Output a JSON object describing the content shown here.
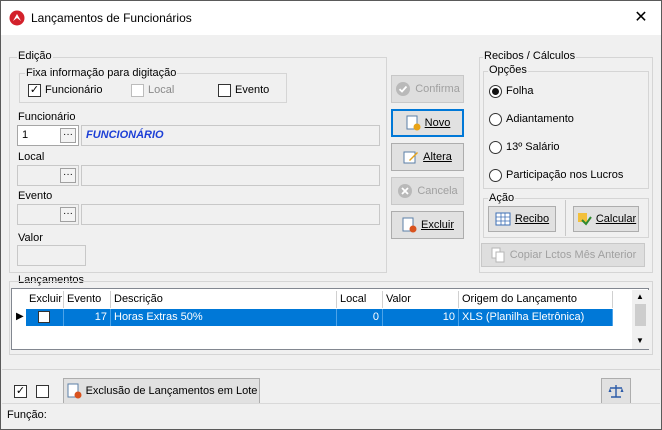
{
  "window": {
    "title": "Lançamentos de Funcionários",
    "close_glyph": "✕"
  },
  "edicao": {
    "group_label": "Edição",
    "fixa_label": "Fixa informação para digitação",
    "check_funcionario": "Funcionário",
    "check_local": "Local",
    "check_evento": "Evento",
    "funcionario_label": "Funcionário",
    "funcionario_code": "1",
    "funcionario_name": "FUNCIONÁRIO",
    "local_label": "Local",
    "evento_label": "Evento",
    "valor_label": "Valor",
    "dots": "···"
  },
  "buttons": {
    "confirma": "Confirma",
    "novo": "Novo",
    "altera": "Altera",
    "cancela": "Cancela",
    "excluir": "Excluir"
  },
  "recibos": {
    "group_label": "Recibos / Cálculos",
    "opcoes_label": "Opções",
    "options": [
      "Folha",
      "Adiantamento",
      "13º Salário",
      "Participação nos Lucros"
    ],
    "selected": "Folha",
    "acao_label": "Ação",
    "recibo": "Recibo",
    "calcular": "Calcular",
    "copiar": "Copiar Lctos Mês Anterior"
  },
  "lancamentos": {
    "group_label": "Lançamentos",
    "columns": [
      "Excluir",
      "Evento",
      "Descrição",
      "Local",
      "Valor",
      "Origem do Lançamento"
    ],
    "rows": [
      {
        "excluir": "",
        "evento": "17",
        "descricao": "Horas Extras 50%",
        "local": "0",
        "valor": "10",
        "origem": "XLS (Planilha Eletrônica)"
      }
    ]
  },
  "footer": {
    "exclusao_button": "Exclusão de Lançamentos em Lote",
    "funcao_label": "Função:"
  },
  "colors": {
    "accent": "#0078d7",
    "link_text": "#1c3fd6"
  }
}
